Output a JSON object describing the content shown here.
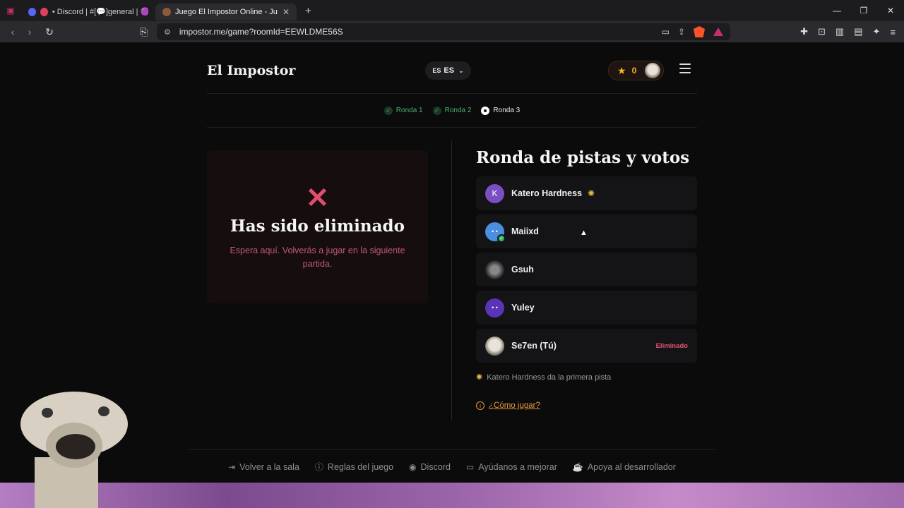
{
  "browser": {
    "tabs": [
      {
        "label": "• Discord | #[💬]general | 🟣n't",
        "active": false
      },
      {
        "label": "Juego El Impostor Online - Jugar",
        "active": true
      }
    ],
    "url": "impostor.me/game?roomId=EEWLDME56S",
    "new_tab": "+",
    "window_controls": [
      "—",
      "❐",
      "✕"
    ]
  },
  "header": {
    "logo": "El Impostor",
    "lang_flag": "ES",
    "lang_code": "ES",
    "score": "0"
  },
  "rounds": [
    {
      "label": "Ronda 1",
      "state": "done"
    },
    {
      "label": "Ronda 2",
      "state": "done"
    },
    {
      "label": "Ronda 3",
      "state": "current"
    }
  ],
  "eliminated": {
    "icon": "✕",
    "title": "Has sido eliminado",
    "subtitle": "Espera aquí. Volverás a jugar en la siguiente partida."
  },
  "voting": {
    "title": "Ronda de pistas y votos",
    "players": [
      {
        "name": "Katero Hardness",
        "avatar_letter": "K",
        "avatar_color": "#7a4fc4",
        "first_clue": true,
        "tag": ""
      },
      {
        "name": "Maiixd",
        "avatar_letter": "",
        "avatar_color": "#4a8fe0",
        "voted": true,
        "tag": ""
      },
      {
        "name": "Gsuh",
        "avatar_letter": "",
        "avatar_color": "#3b3b3f",
        "tag": ""
      },
      {
        "name": "Yuley",
        "avatar_letter": "",
        "avatar_color": "#5b33b6",
        "tag": ""
      },
      {
        "name": "Se7en (Tú)",
        "avatar_letter": "",
        "avatar_color": "#cfc8bd",
        "tag": "Eliminado"
      }
    ],
    "hint": "Katero Hardness da la primera pista",
    "howto": "¿Cómo jugar?"
  },
  "footer": {
    "links": [
      {
        "label": "Volver a la sala",
        "icon": "exit-icon"
      },
      {
        "label": "Reglas del juego",
        "icon": "info-icon"
      },
      {
        "label": "Discord",
        "icon": "discord-icon"
      },
      {
        "label": "Ayúdanos a mejorar",
        "icon": "feedback-icon"
      },
      {
        "label": "Apoya al desarrollador",
        "icon": "coffee-icon"
      }
    ]
  },
  "colors": {
    "accent_red": "#e34d6f",
    "accent_green": "#4caf6a",
    "accent_orange": "#e89a3a",
    "gold": "#f2b81d"
  }
}
